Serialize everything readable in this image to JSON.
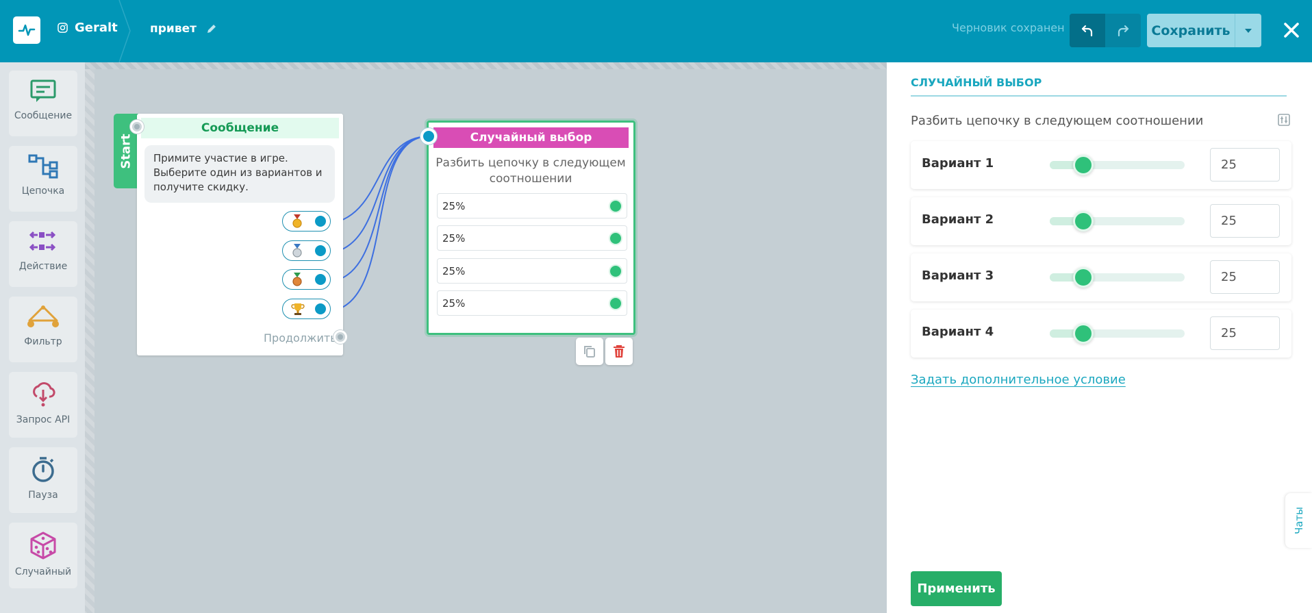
{
  "header": {
    "account_name": "Geralt",
    "flow_name": "привет",
    "draft_status": "Черновик сохранен",
    "save_label": "Сохранить"
  },
  "toolbar": {
    "items": [
      {
        "label": "Сообщение",
        "icon": "message-icon",
        "color": "#2b9a6a"
      },
      {
        "label": "Цепочка",
        "icon": "chain-icon",
        "color": "#2f78b5"
      },
      {
        "label": "Действие",
        "icon": "action-icon",
        "color": "#8a4fc4"
      },
      {
        "label": "Фильтр",
        "icon": "filter-icon",
        "color": "#e0a23a"
      },
      {
        "label": "Запрос API",
        "icon": "api-icon",
        "color": "#c24a6a"
      },
      {
        "label": "Пауза",
        "icon": "pause-timer-icon",
        "color": "#3c6c8f"
      },
      {
        "label": "Случайный",
        "icon": "dice-icon",
        "color": "#c74aa7"
      }
    ]
  },
  "canvas": {
    "start_label": "Start",
    "message_node": {
      "title": "Сообщение",
      "text_lines": [
        "Примите участие в игре.",
        "Выберите один из вариантов и",
        "получите скидку."
      ],
      "buttons": [
        {
          "icon": "gold-medal-icon"
        },
        {
          "icon": "silver-medal-icon"
        },
        {
          "icon": "bronze-medal-icon"
        },
        {
          "icon": "trophy-icon"
        }
      ],
      "continue_label": "Продолжить"
    },
    "random_node": {
      "title": "Случайный выбор",
      "desc_lines": [
        "Разбить цепочку в следующем",
        "соотношении"
      ],
      "rows": [
        "25%",
        "25%",
        "25%",
        "25%"
      ]
    }
  },
  "panel": {
    "heading": "СЛУЧАЙНЫЙ ВЫБОР",
    "subtitle": "Разбить цепочку в следующем соотношении",
    "variants": [
      {
        "label": "Вариант 1",
        "value": "25",
        "fraction": 0.25
      },
      {
        "label": "Вариант 2",
        "value": "25",
        "fraction": 0.25
      },
      {
        "label": "Вариант 3",
        "value": "25",
        "fraction": 0.25
      },
      {
        "label": "Вариант 4",
        "value": "25",
        "fraction": 0.25
      }
    ],
    "extra_condition_link": "Задать дополнительное условие",
    "apply_label": "Применить",
    "chats_tab": "Чаты"
  },
  "colors": {
    "brand": "#0196b7",
    "accent_green": "#2fc17a",
    "random_pink": "#d94db5"
  }
}
